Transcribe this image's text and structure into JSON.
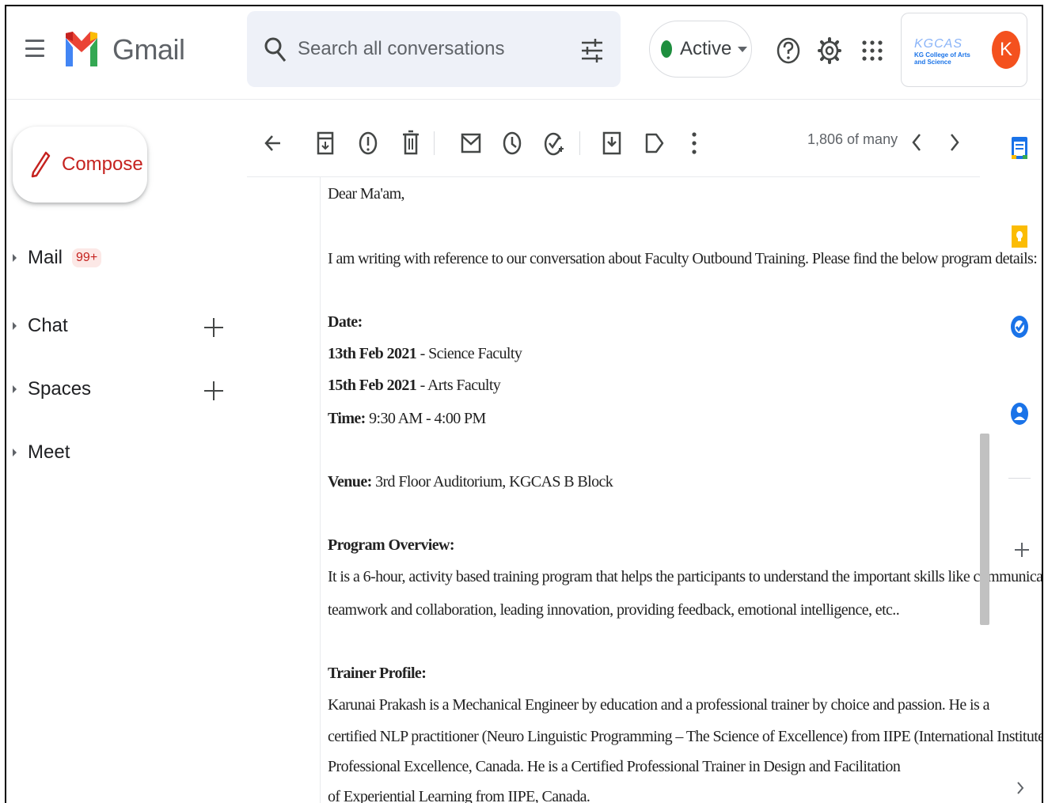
{
  "app": {
    "name": "Gmail"
  },
  "search": {
    "placeholder": "Search all conversations"
  },
  "status": {
    "label": "Active",
    "color": "#1e8e3e"
  },
  "account": {
    "org_logo_text": "KGCAS",
    "org_logo_subtext": "KG College of Arts and Science",
    "avatar_letter": "K"
  },
  "compose": {
    "label": "Compose"
  },
  "nav": {
    "items": [
      {
        "label": "Mail",
        "badge": "99+"
      },
      {
        "label": "Chat"
      },
      {
        "label": "Spaces"
      },
      {
        "label": "Meet"
      }
    ]
  },
  "toolbar": {
    "pager": "1,806 of many"
  },
  "message": {
    "greeting": "Dear Ma'am,",
    "intro": "I am writing with reference to our conversation about Faculty Outbound Training. Please find the below program details:",
    "date_label": "Date:",
    "date1_bold": "13th Feb 2021",
    "date1_rest": " - Science Faculty",
    "date2_bold": "15th Feb 2021",
    "date2_rest": " - Arts Faculty",
    "time_label": "Time:",
    "time_value": " 9:30 AM - 4:00 PM",
    "venue_label": "Venue:",
    "venue_value": " 3rd Floor Auditorium, KGCAS B Block",
    "overview_label": "Program Overview:",
    "overview_line1": "It is a 6-hour, activity based training program that helps the participants to understand the important skills like communication,",
    "overview_line2": "teamwork and collaboration, leading innovation, providing feedback, emotional intelligence, etc..",
    "trainer_label": "Trainer Profile:",
    "trainer_line1": "Karunai Prakash is a Mechanical Engineer by education and a professional trainer by choice and passion. He is a",
    "trainer_line2": "certified  NLP practitioner  (Neuro Linguistic Programming – The Science of Excellence) from IIPE (International Institute for",
    "trainer_line3": "Professional Excellence, Canada. He is a Certified Professional Trainer in Design and Facilitation",
    "trainer_line4": "of Experiential Learning from IIPE, Canada."
  }
}
